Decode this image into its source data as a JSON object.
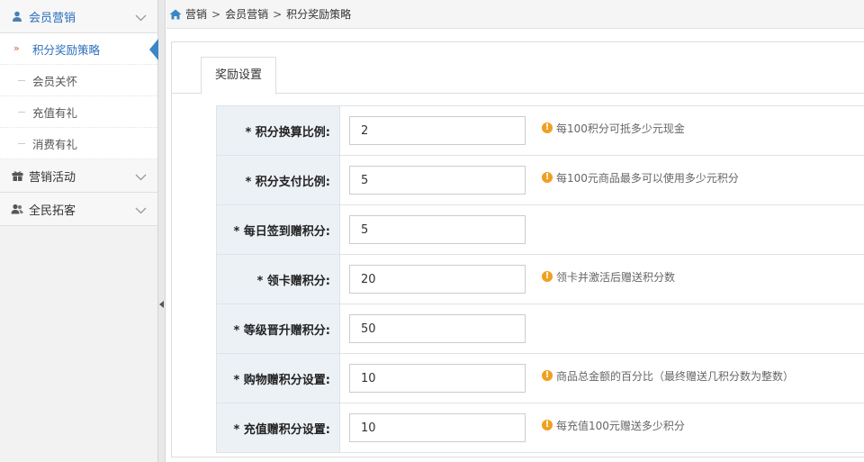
{
  "sidebar": {
    "groups": [
      {
        "label": "会员营销",
        "icon": "user-icon",
        "expanded": true,
        "items": [
          {
            "label": "积分奖励策略",
            "active": true
          },
          {
            "label": "会员关怀"
          },
          {
            "label": "充值有礼"
          },
          {
            "label": "消费有礼"
          }
        ]
      },
      {
        "label": "营销活动",
        "icon": "gift-icon"
      },
      {
        "label": "全民拓客",
        "icon": "users-icon"
      }
    ]
  },
  "breadcrumb": {
    "items": [
      "营销",
      "会员营销",
      "积分奖励策略"
    ],
    "separator": ">"
  },
  "tabs": [
    {
      "label": "奖励设置",
      "active": true
    }
  ],
  "form": {
    "rows": [
      {
        "label": "* 积分换算比例:",
        "value": "2",
        "hint": "每100积分可抵多少元现金"
      },
      {
        "label": "* 积分支付比例:",
        "value": "5",
        "hint": "每100元商品最多可以使用多少元积分"
      },
      {
        "label": "* 每日签到赠积分:",
        "value": "5",
        "hint": ""
      },
      {
        "label": "* 领卡赠积分:",
        "value": "20",
        "hint": "领卡并激活后赠送积分数"
      },
      {
        "label": "* 等级晋升赠积分:",
        "value": "50",
        "hint": ""
      },
      {
        "label": "* 购物赠积分设置:",
        "value": "10",
        "hint": "商品总金额的百分比（最终赠送几积分数为整数）"
      },
      {
        "label": "* 充值赠积分设置:",
        "value": "10",
        "hint": "每充值100元赠送多少积分"
      }
    ]
  },
  "colors": {
    "accent": "#2a6ebb",
    "label_bg": "#ecf1f6",
    "warn": "#f0a020"
  }
}
